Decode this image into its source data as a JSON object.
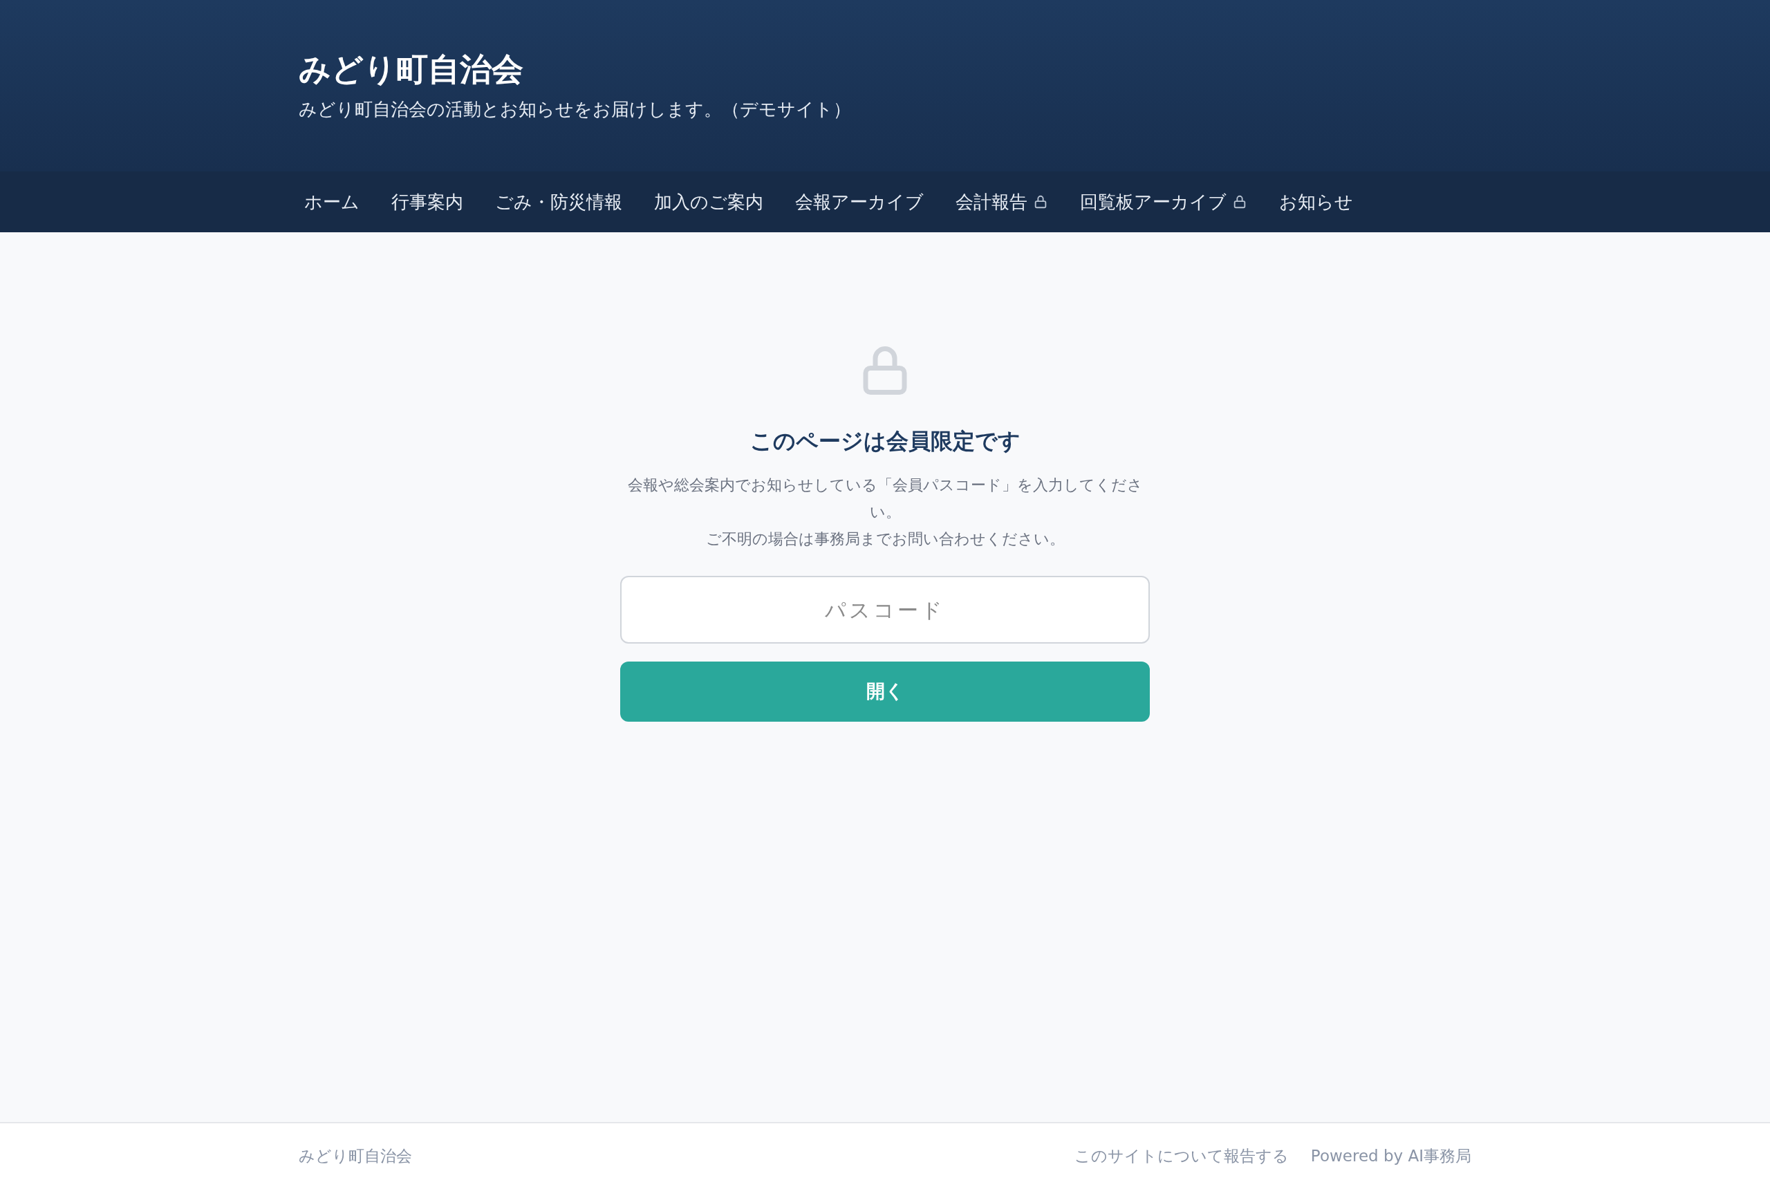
{
  "header": {
    "title": "みどり町自治会",
    "tagline": "みどり町自治会の活動とお知らせをお届けします。（デモサイト）"
  },
  "nav": [
    {
      "label": "ホーム",
      "locked": false
    },
    {
      "label": "行事案内",
      "locked": false
    },
    {
      "label": "ごみ・防災情報",
      "locked": false
    },
    {
      "label": "加入のご案内",
      "locked": false
    },
    {
      "label": "会報アーカイブ",
      "locked": false
    },
    {
      "label": "会計報告",
      "locked": true
    },
    {
      "label": "回覧板アーカイブ",
      "locked": true
    },
    {
      "label": "お知らせ",
      "locked": false
    }
  ],
  "gate": {
    "title": "このページは会員限定です",
    "lines": [
      "会報や総会案内でお知らせしている「会員パスコード」を入力してください。",
      "ご不明の場合は事務局までお問い合わせください。"
    ],
    "field": {
      "placeholder": "パスコード"
    },
    "button": "開く"
  },
  "footer": {
    "site": "みどり町自治会",
    "links": [
      "このサイトについて報告する",
      "Powered by AI事務局"
    ]
  }
}
